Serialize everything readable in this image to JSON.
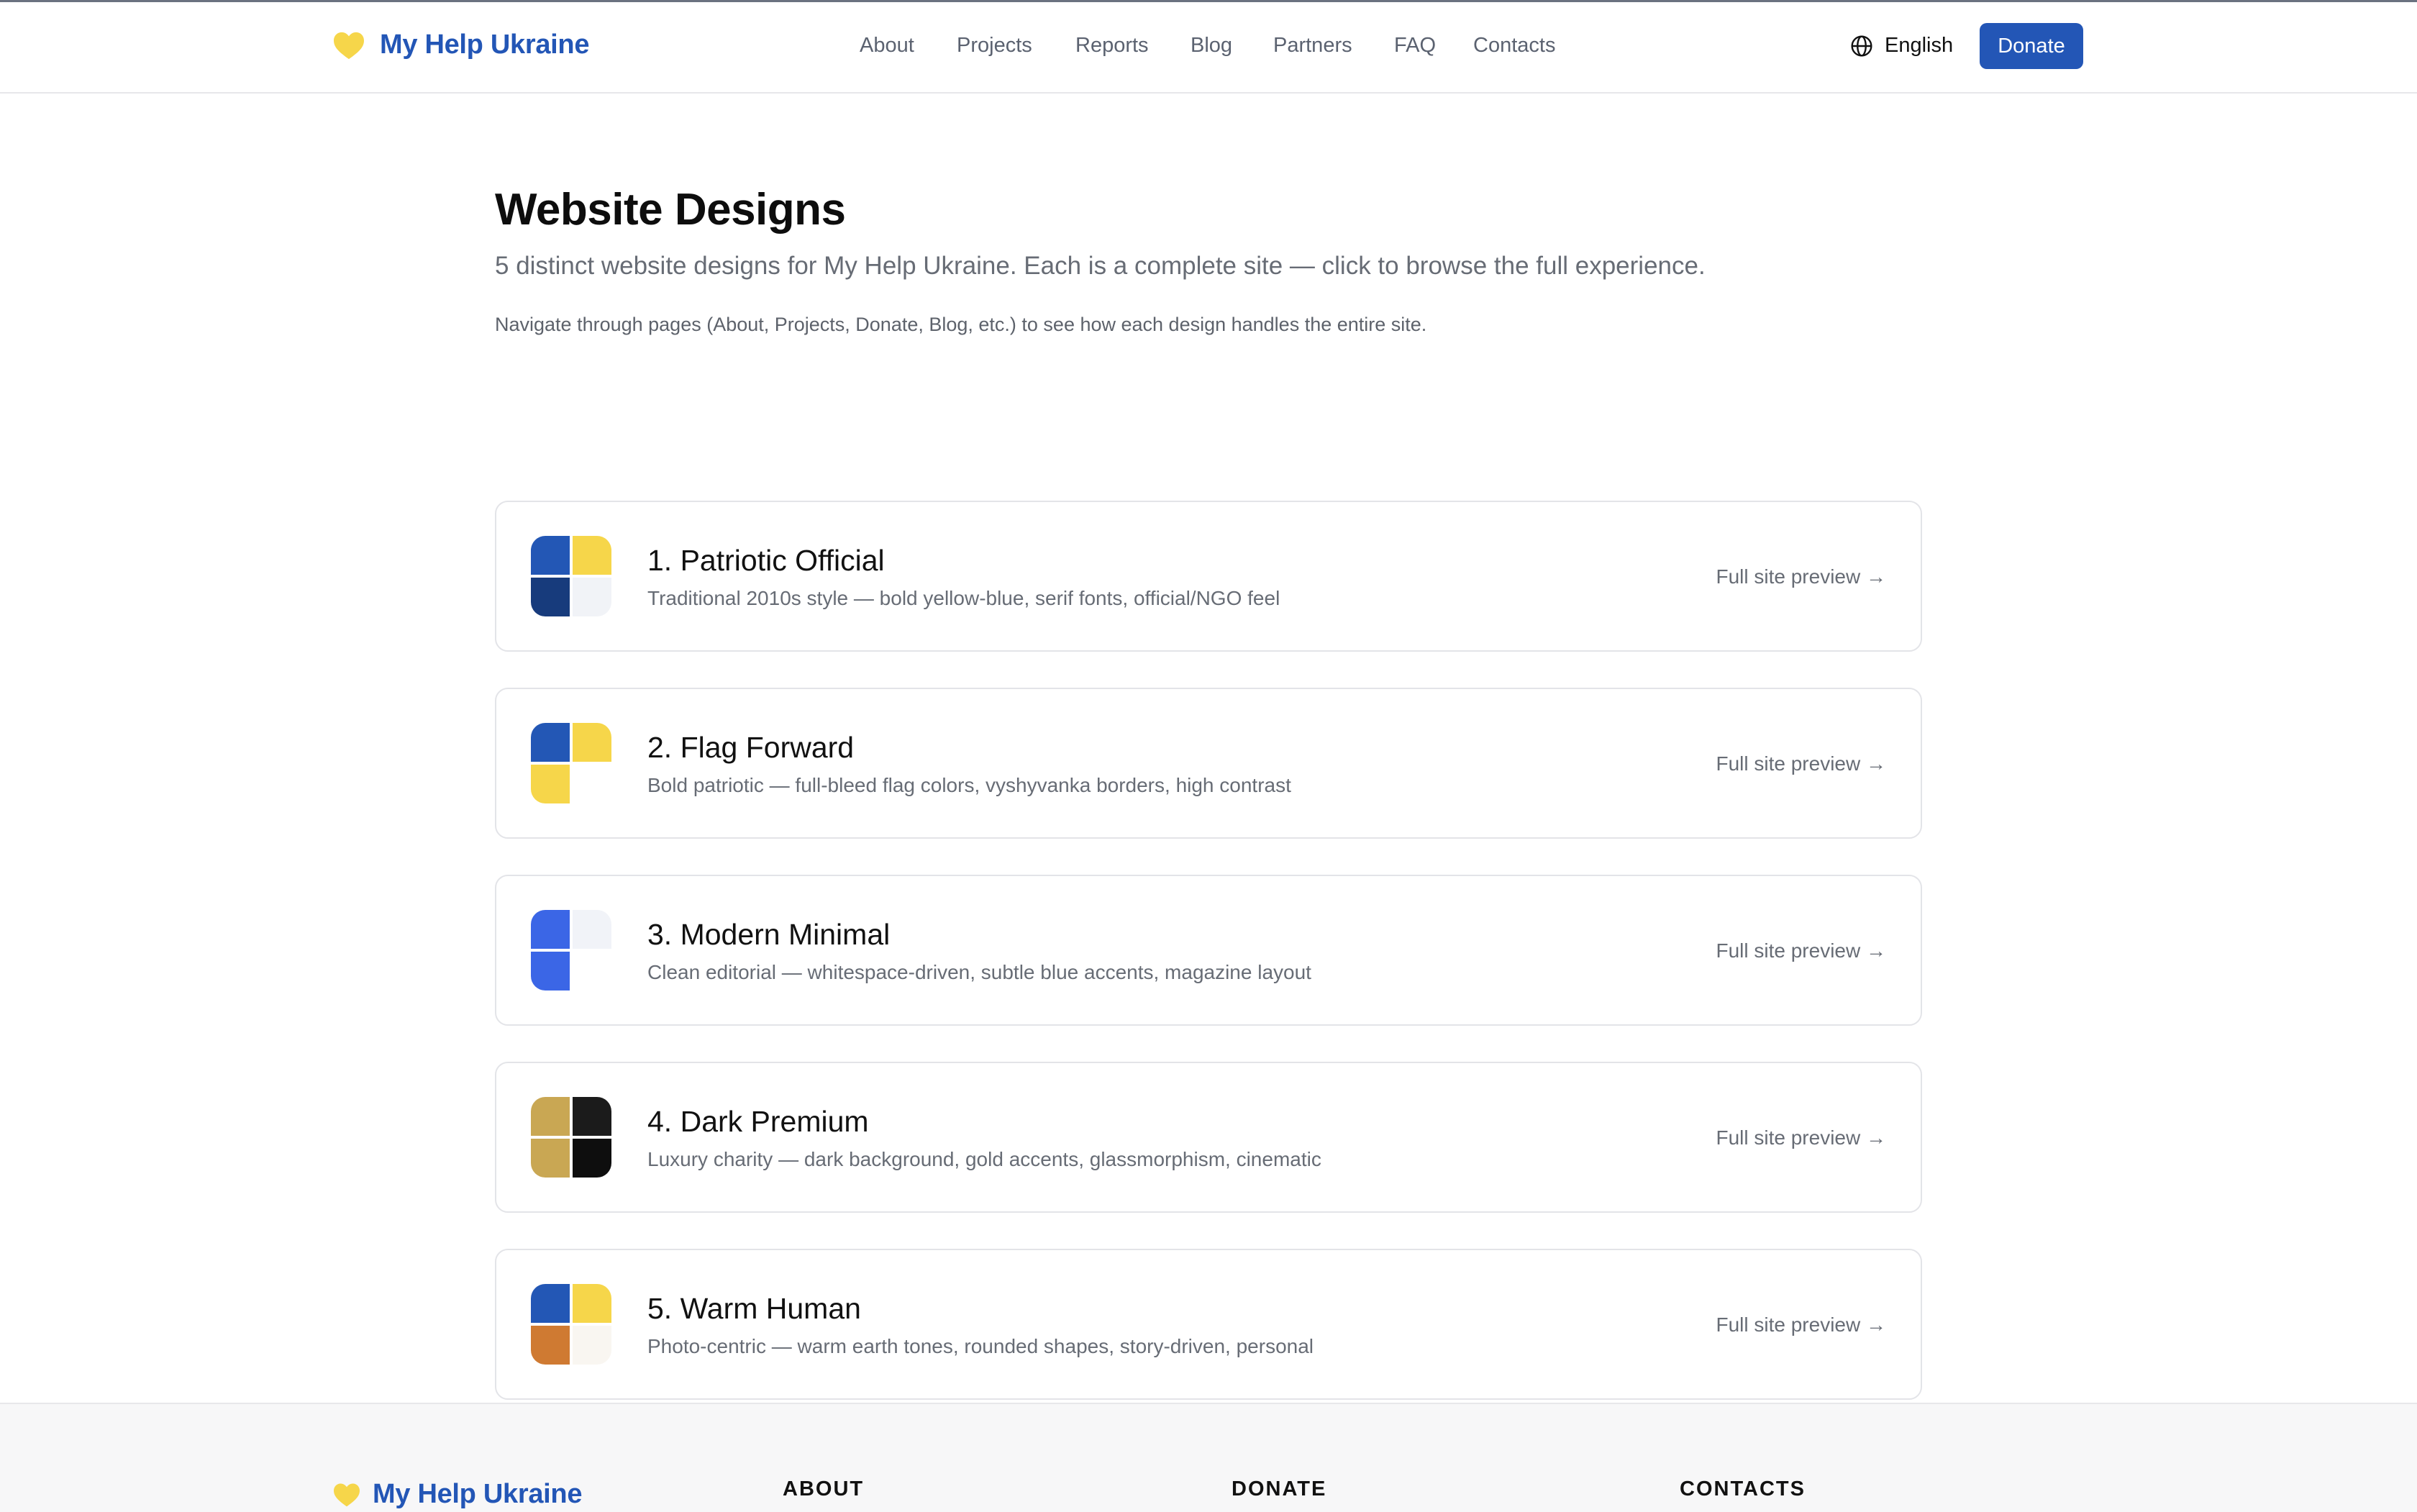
{
  "header": {
    "brand": "My Help Ukraine",
    "nav": [
      "About",
      "Projects",
      "Reports",
      "Blog",
      "Partners",
      "FAQ",
      "Contacts"
    ],
    "language": "English",
    "donate_label": "Donate"
  },
  "main": {
    "title": "Website Designs",
    "subtitle": "5 distinct website designs for My Help Ukraine. Each is a complete site — click to browse the full experience.",
    "note": "Navigate through pages (About, Projects, Donate, Blog, etc.) to see how each design handles the entire site.",
    "designs": [
      {
        "title": "1. Patriotic Official",
        "description": "Traditional 2010s style — bold yellow-blue, serif fonts, official/NGO feel",
        "link": "Full site preview →",
        "colors": [
          "#2357b5",
          "#f6d64a",
          "#173b7c",
          "#f1f3f7"
        ]
      },
      {
        "title": "2. Flag Forward",
        "description": "Bold patriotic — full-bleed flag colors, vyshyvanka borders, high contrast",
        "link": "Full site preview →",
        "colors": [
          "#2357b5",
          "#f6d64a",
          "#f6d64a",
          "#ffffff"
        ]
      },
      {
        "title": "3. Modern Minimal",
        "description": "Clean editorial — whitespace-driven, subtle blue accents, magazine layout",
        "link": "Full site preview →",
        "colors": [
          "#3b66e6",
          "#f1f3f8",
          "#3b66e6",
          "#ffffff"
        ]
      },
      {
        "title": "4. Dark Premium",
        "description": "Luxury charity — dark background, gold accents, glassmorphism, cinematic",
        "link": "Full site preview →",
        "colors": [
          "#c9a753",
          "#1b1b1b",
          "#c9a753",
          "#0e0e0e"
        ]
      },
      {
        "title": "5. Warm Human",
        "description": "Photo-centric — warm earth tones, rounded shapes, story-driven, personal",
        "link": "Full site preview →",
        "colors": [
          "#2357b5",
          "#f6d64a",
          "#cf7a32",
          "#f9f6f1"
        ]
      }
    ]
  },
  "footer": {
    "brand": "My Help Ukraine",
    "columns": [
      "ABOUT",
      "DONATE",
      "CONTACTS"
    ]
  },
  "colors": {
    "brand_blue": "#2356b6",
    "heart_yellow": "#f6d64a",
    "muted_text": "#676c75",
    "card_border": "#e3e4e8"
  }
}
